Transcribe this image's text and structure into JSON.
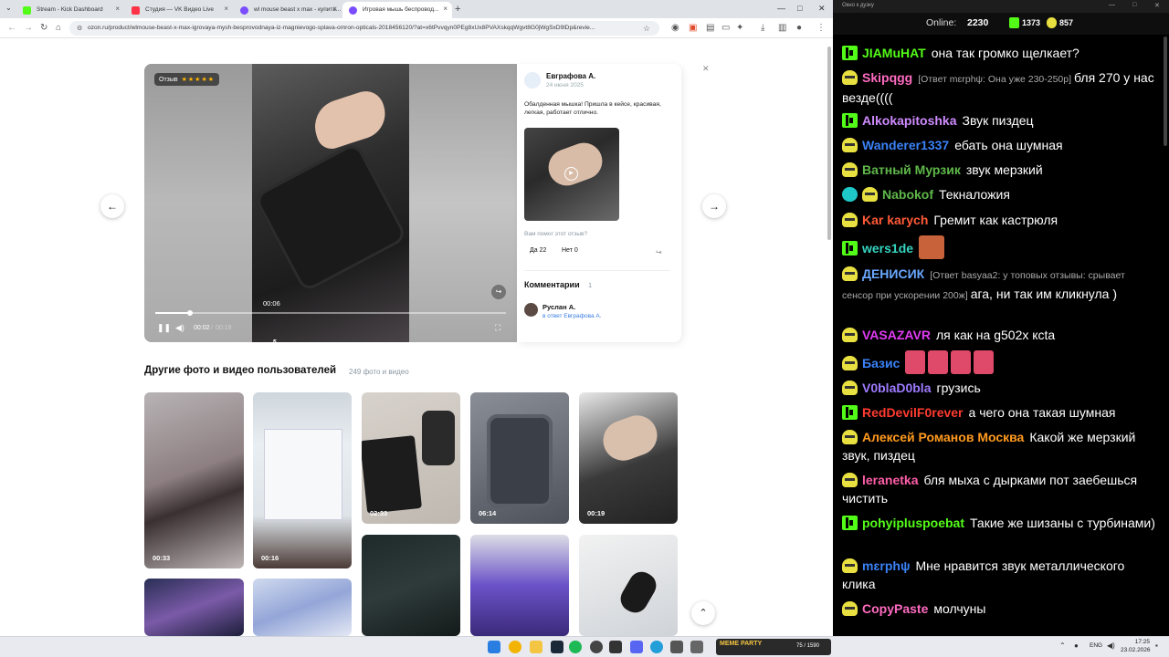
{
  "browser": {
    "tabs": [
      {
        "title": "Stream - Kick Dashboard",
        "color": "#53fc18"
      },
      {
        "title": "Студия — VK Видео Live",
        "color": "#ff3347"
      },
      {
        "title": "wl mouse beast x max - купить...",
        "color": "#7b4dff"
      },
      {
        "title": "Игровая мышь беспровод...",
        "color": "#7b4dff"
      }
    ],
    "url": "ozon.ru/product/wlmouse-beast-x-max-igrovaya-mysh-besprovodnaya-iz-magnievogo-splava-omron-opticals-2018456120/?at=x6tPvvqyn0PEg8xUx8PVAXskqqWgvt8G0jWgSxD9lDp&revie..."
  },
  "player": {
    "badge_label": "Отзыв",
    "stars": "★★★★★",
    "hover_time": "00:06",
    "current_time": "00:02",
    "time_sep": "/",
    "total_time": "00:19",
    "progress": 0.1,
    "hover_progress": 0.33
  },
  "review": {
    "author": "Евграфова А.",
    "date": "24 июня 2025",
    "text": "Обалденная мышка! Пришла в кейсе, красивая, легкая, работает отлично.",
    "helpful_question": "Вам помог этот отзыв?",
    "yes_label": "Да 22",
    "no_label": "Нет 0",
    "comments_title": "Комментарии",
    "comments_count": "1",
    "comment_author": "Руслан А.",
    "comment_reply": "в ответ Евграфова А."
  },
  "gallery": {
    "title": "Другие фото и видео пользователей",
    "count": "249 фото и видео",
    "durations": [
      "00:33",
      "00:16",
      "02:33",
      "06:14",
      "00:19"
    ]
  },
  "chat_window": {
    "title": "Окно к дузку",
    "online_label": "Online:",
    "online_count": "2230",
    "kick_count": "1373",
    "yellow_count": "857"
  },
  "chat": [
    {
      "badge": "kick",
      "nick": "JIAMuHAT",
      "color": "#53fc18",
      "text": "она так громко щелкает?"
    },
    {
      "badge": "yellow",
      "nick": "Skipqgg",
      "color": "#ff6bc1",
      "reply": "[Ответ mɛrphψ: Она уже 230-250р]",
      "text": "бля 270 у нас везде(((("
    },
    {
      "badge": "kick",
      "nick": "Alkokapitoshka",
      "color": "#cf8bff",
      "text": "Звук пиздец"
    },
    {
      "badge": "yellow",
      "nick": "Wanderer1337",
      "color": "#3a82f7",
      "text": "ебать она шумная"
    },
    {
      "badge": "yellow",
      "nick": "Ватный Мурзик",
      "color": "#5fb84a",
      "text": "звук мерзкий"
    },
    {
      "badge": "verified",
      "nick": "Nabokof",
      "color": "#5fb84a",
      "text": "Текналожия"
    },
    {
      "badge": "yellow",
      "nick": "Kar karych",
      "color": "#ff5a36",
      "text": "Гремит как кастрюля"
    },
    {
      "badge": "kick",
      "nick": "wers1de",
      "color": "#35d4c0",
      "text": ""
    },
    {
      "badge": "yellow",
      "nick": "ДЕНИСИК",
      "color": "#6aa8ff",
      "reply": "[Ответ basyaa2: у топовых отзывы: срывает сенсор при ускорении 200ж]",
      "text": "ага, ни так им кликнула )"
    },
    {
      "badge": "yellow",
      "nick": "VASAZAVR",
      "color": "#e03bf2",
      "text": "ля как на g502x ксta"
    },
    {
      "badge": "yellow",
      "nick": "Базис",
      "color": "#3a82f7",
      "text": ""
    },
    {
      "badge": "yellow",
      "nick": "V0blaD0bla",
      "color": "#9e7bff",
      "text": "грузись"
    },
    {
      "badge": "kick",
      "nick": "RedDevilF0rever",
      "color": "#ff3b30",
      "text": "а чего она такая шумная"
    },
    {
      "badge": "yellow",
      "nick": "Алексей Романов Москва",
      "color": "#ff9a1f",
      "text": "Какой же мерзкий звук, пиздец"
    },
    {
      "badge": "yellow",
      "nick": "leranetka",
      "color": "#ff5ea8",
      "text": "бля мыха с дырками пот заебешься чистить"
    },
    {
      "badge": "kick",
      "nick": "pohyipluspoebat",
      "color": "#53fc18",
      "text": "Такие же шизаны с турбинами)"
    },
    {
      "badge": "yellow",
      "nick": "mɛrphψ",
      "color": "#3a82f7",
      "text": "Мне нравится звук металлического клика"
    },
    {
      "badge": "yellow",
      "nick": "CopyPaste",
      "color": "#ff6bc1",
      "text": "молчуны"
    }
  ],
  "taskbar": {
    "widget_logo": "MEME PARTY",
    "widget_value": "75 / 1590",
    "lang": "ENG",
    "time": "17:25",
    "date": "23.02.2026"
  }
}
